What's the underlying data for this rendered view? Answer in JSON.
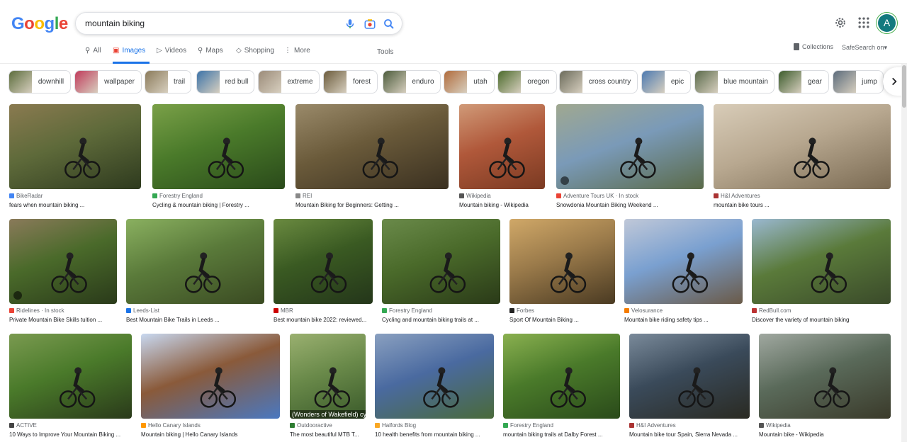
{
  "search": {
    "query": "mountain biking"
  },
  "header": {
    "logo_letters": [
      {
        "ch": "G",
        "color": "#4285f4"
      },
      {
        "ch": "o",
        "color": "#ea4335"
      },
      {
        "ch": "o",
        "color": "#fbbc05"
      },
      {
        "ch": "g",
        "color": "#4285f4"
      },
      {
        "ch": "l",
        "color": "#34a853"
      },
      {
        "ch": "e",
        "color": "#ea4335"
      }
    ],
    "avatar_letter": "A"
  },
  "tabs": [
    {
      "label": "All",
      "icon": "search-icon"
    },
    {
      "label": "Images",
      "icon": "image-icon",
      "active": true
    },
    {
      "label": "Videos",
      "icon": "play-icon"
    },
    {
      "label": "Maps",
      "icon": "map-pin-icon"
    },
    {
      "label": "Shopping",
      "icon": "tag-icon"
    },
    {
      "label": "More",
      "icon": "more-vert-icon"
    }
  ],
  "tools_label": "Tools",
  "collections_label": "Collections",
  "safesearch_label": "SafeSearch on",
  "chips": [
    {
      "label": "downhill"
    },
    {
      "label": "wallpaper"
    },
    {
      "label": "trail"
    },
    {
      "label": "red bull"
    },
    {
      "label": "extreme"
    },
    {
      "label": "forest"
    },
    {
      "label": "enduro"
    },
    {
      "label": "utah"
    },
    {
      "label": "oregon"
    },
    {
      "label": "cross country"
    },
    {
      "label": "epic"
    },
    {
      "label": "blue mountain"
    },
    {
      "label": "gear"
    },
    {
      "label": "jump"
    }
  ],
  "results": [
    {
      "source": "BikeRadar",
      "title": "fears when mountain biking ..."
    },
    {
      "source": "Forestry England",
      "title": "Cycling & mountain biking | Forestry ..."
    },
    {
      "source": "REI",
      "title": "Mountain Biking for Beginners: Getting ..."
    },
    {
      "source": "Wikipedia",
      "title": "Mountain biking - Wikipedia"
    },
    {
      "source": "Adventure Tours UK · In stock",
      "title": "Snowdonia Mountain Biking Weekend ..."
    },
    {
      "source": "H&I Adventures",
      "title": "mountain bike tours ..."
    },
    {
      "source": "Ridelines · In stock",
      "title": "Private Mountain Bike Skills tuition ..."
    },
    {
      "source": "Leeds-List",
      "title": "Best Mountain Bike Trails in Leeds ..."
    },
    {
      "source": "MBR",
      "title": "Best mountain bike 2022: reviewed..."
    },
    {
      "source": "Forestry England",
      "title": "Cycling and mountain biking trails at ..."
    },
    {
      "source": "Forbes",
      "title": "Sport Of Mountain Biking ..."
    },
    {
      "source": "Velosurance",
      "title": "Mountain bike riding safety tips ..."
    },
    {
      "source": "RedBull.com",
      "title": "Discover the variety of mountain biking"
    },
    {
      "source": "ACTIVE",
      "title": "10 Ways to Improve Your Mountain Biking ..."
    },
    {
      "source": "Hello Canary Islands",
      "title": "Mountain biking | Hello Canary Islands"
    },
    {
      "source": "Outdooractive",
      "title": "The most beautiful MTB T...",
      "overlay": "(Wonders of Wakefield) cyc"
    },
    {
      "source": "Halfords Blog",
      "title": "10 health benefits from mountain biking ..."
    },
    {
      "source": "Forestry England",
      "title": "mountain biking trails at Dalby Forest ..."
    },
    {
      "source": "H&I Adventures",
      "title": "Mountain bike tour Spain, Sierra Nevada ..."
    },
    {
      "source": "Wikipedia",
      "title": "Mountain bike - Wikipedia"
    }
  ]
}
